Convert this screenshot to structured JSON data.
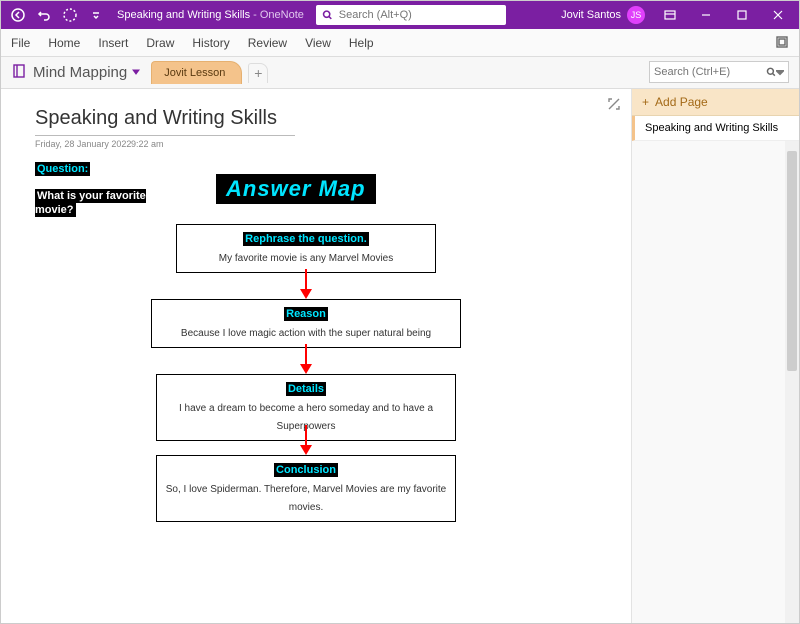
{
  "titlebar": {
    "doc_name": "Speaking and Writing Skills",
    "app_name": "OneNote",
    "separator": " - ",
    "search_placeholder": "Search (Alt+Q)",
    "user_name": "Jovit Santos",
    "user_initials": "JS"
  },
  "ribbon": {
    "tabs": [
      "File",
      "Home",
      "Insert",
      "Draw",
      "History",
      "Review",
      "View",
      "Help"
    ]
  },
  "navrow": {
    "notebook_name": "Mind Mapping",
    "section_name": "Jovit Lesson",
    "add_tab_glyph": "+",
    "page_search_placeholder": "Search (Ctrl+E)"
  },
  "page_panel": {
    "add_page_label": "Add Page",
    "add_page_glyph": "+",
    "pages": [
      "Speaking and Writing Skills"
    ]
  },
  "page": {
    "title": "Speaking and Writing Skills",
    "date": "Friday, 28 January 2022",
    "time": "9:22 am",
    "question_label": "Question:",
    "question_text": "What is your favorite movie?",
    "answer_map_title": "Answer Map",
    "boxes": [
      {
        "head": "Rephrase the question.",
        "text": "My favorite movie is any Marvel Movies"
      },
      {
        "head": "Reason",
        "text": "Because I love magic action with the super natural being"
      },
      {
        "head": "Details",
        "text": "I have a  dream to become a hero someday and to have a Superpowers"
      },
      {
        "head": "Conclusion",
        "text": "So, I love Spiderman. Therefore, Marvel Movies are my favorite movies."
      }
    ]
  },
  "colors": {
    "brand": "#7b1fa2",
    "section_tab": "#f4c38b",
    "highlight_cyan": "#00e5ff",
    "arrow": "#ff0000"
  }
}
